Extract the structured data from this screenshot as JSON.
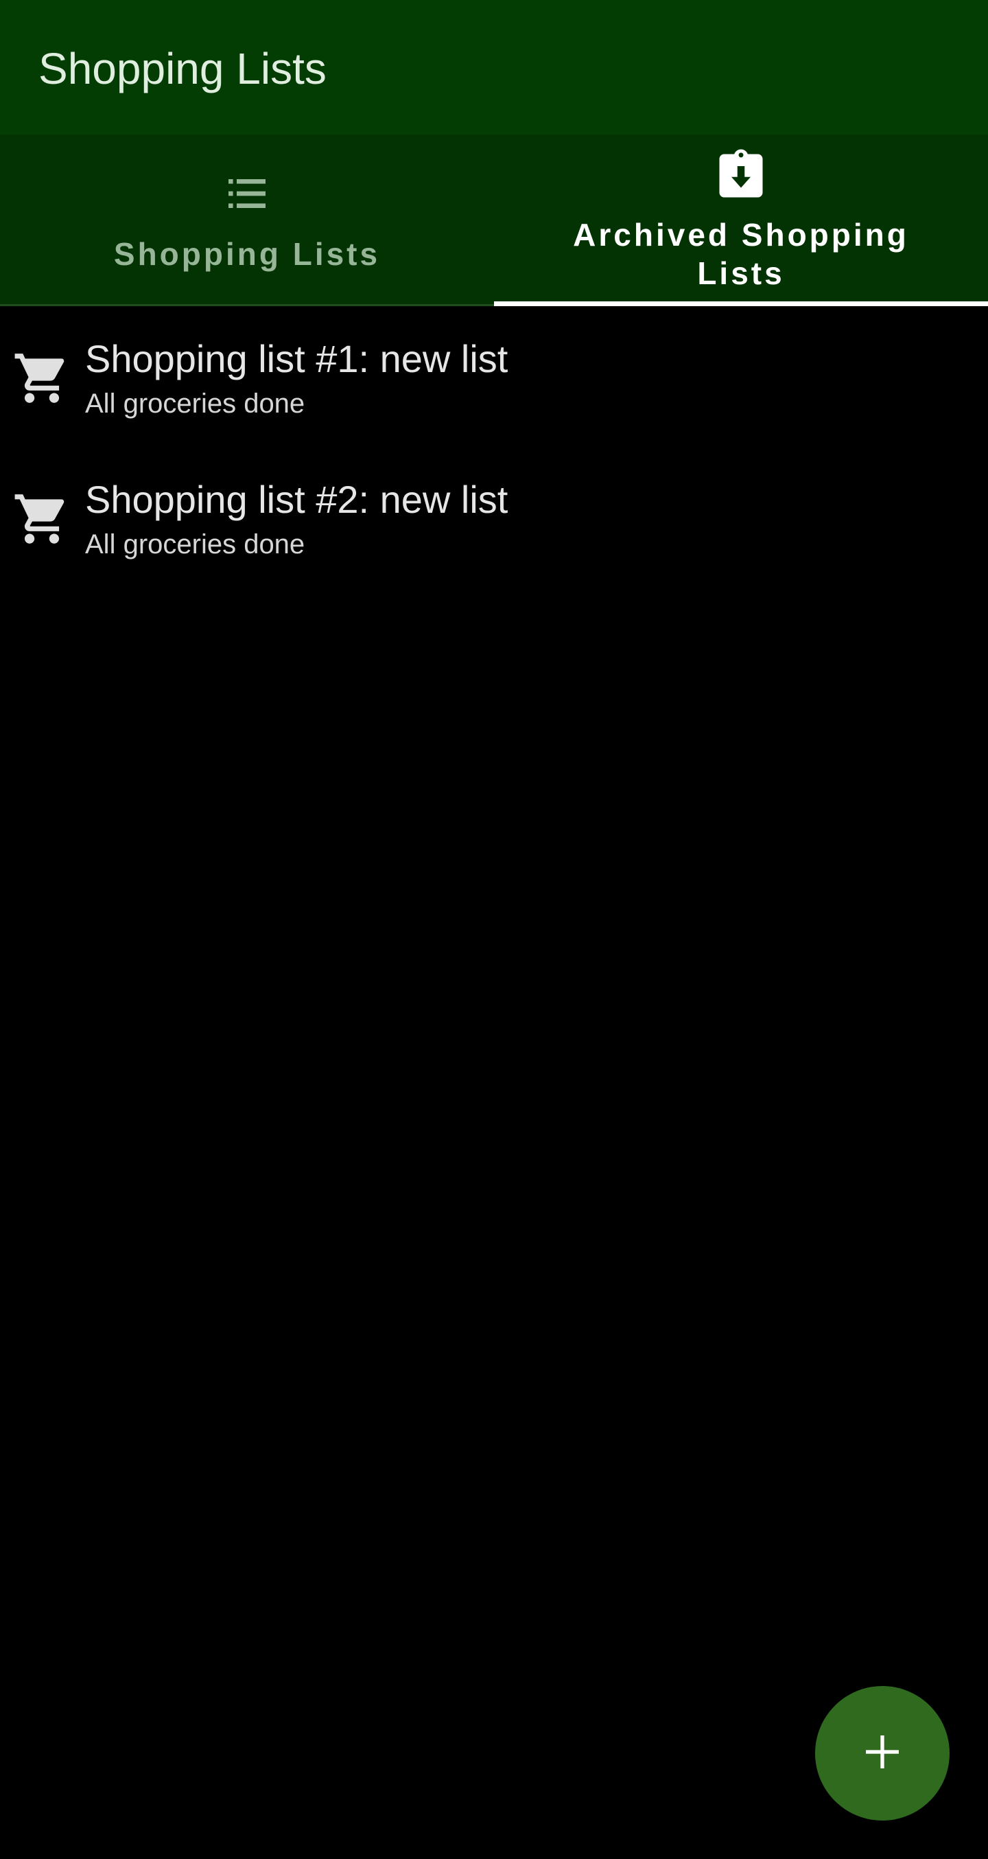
{
  "app_bar": {
    "title": "Shopping Lists"
  },
  "tabs": [
    {
      "label": "Shopping Lists",
      "icon": "list-icon",
      "selected": false
    },
    {
      "label": "Archived Shopping Lists",
      "icon": "archive-clipboard-icon",
      "selected": true
    }
  ],
  "archived_lists": [
    {
      "title": "Shopping list #1: new list",
      "subtitle": "All groceries done",
      "icon": "cart-icon"
    },
    {
      "title": "Shopping list #2: new list",
      "subtitle": "All groceries done",
      "icon": "cart-icon"
    }
  ],
  "fab": {
    "icon": "plus-icon"
  },
  "colors": {
    "app_bar": "#033d03",
    "tab_bar": "#033303",
    "background": "#000000",
    "fab": "#2f6a1f",
    "tab_indicator": "#ffffff",
    "inactive_tab_text": "#97b597"
  }
}
